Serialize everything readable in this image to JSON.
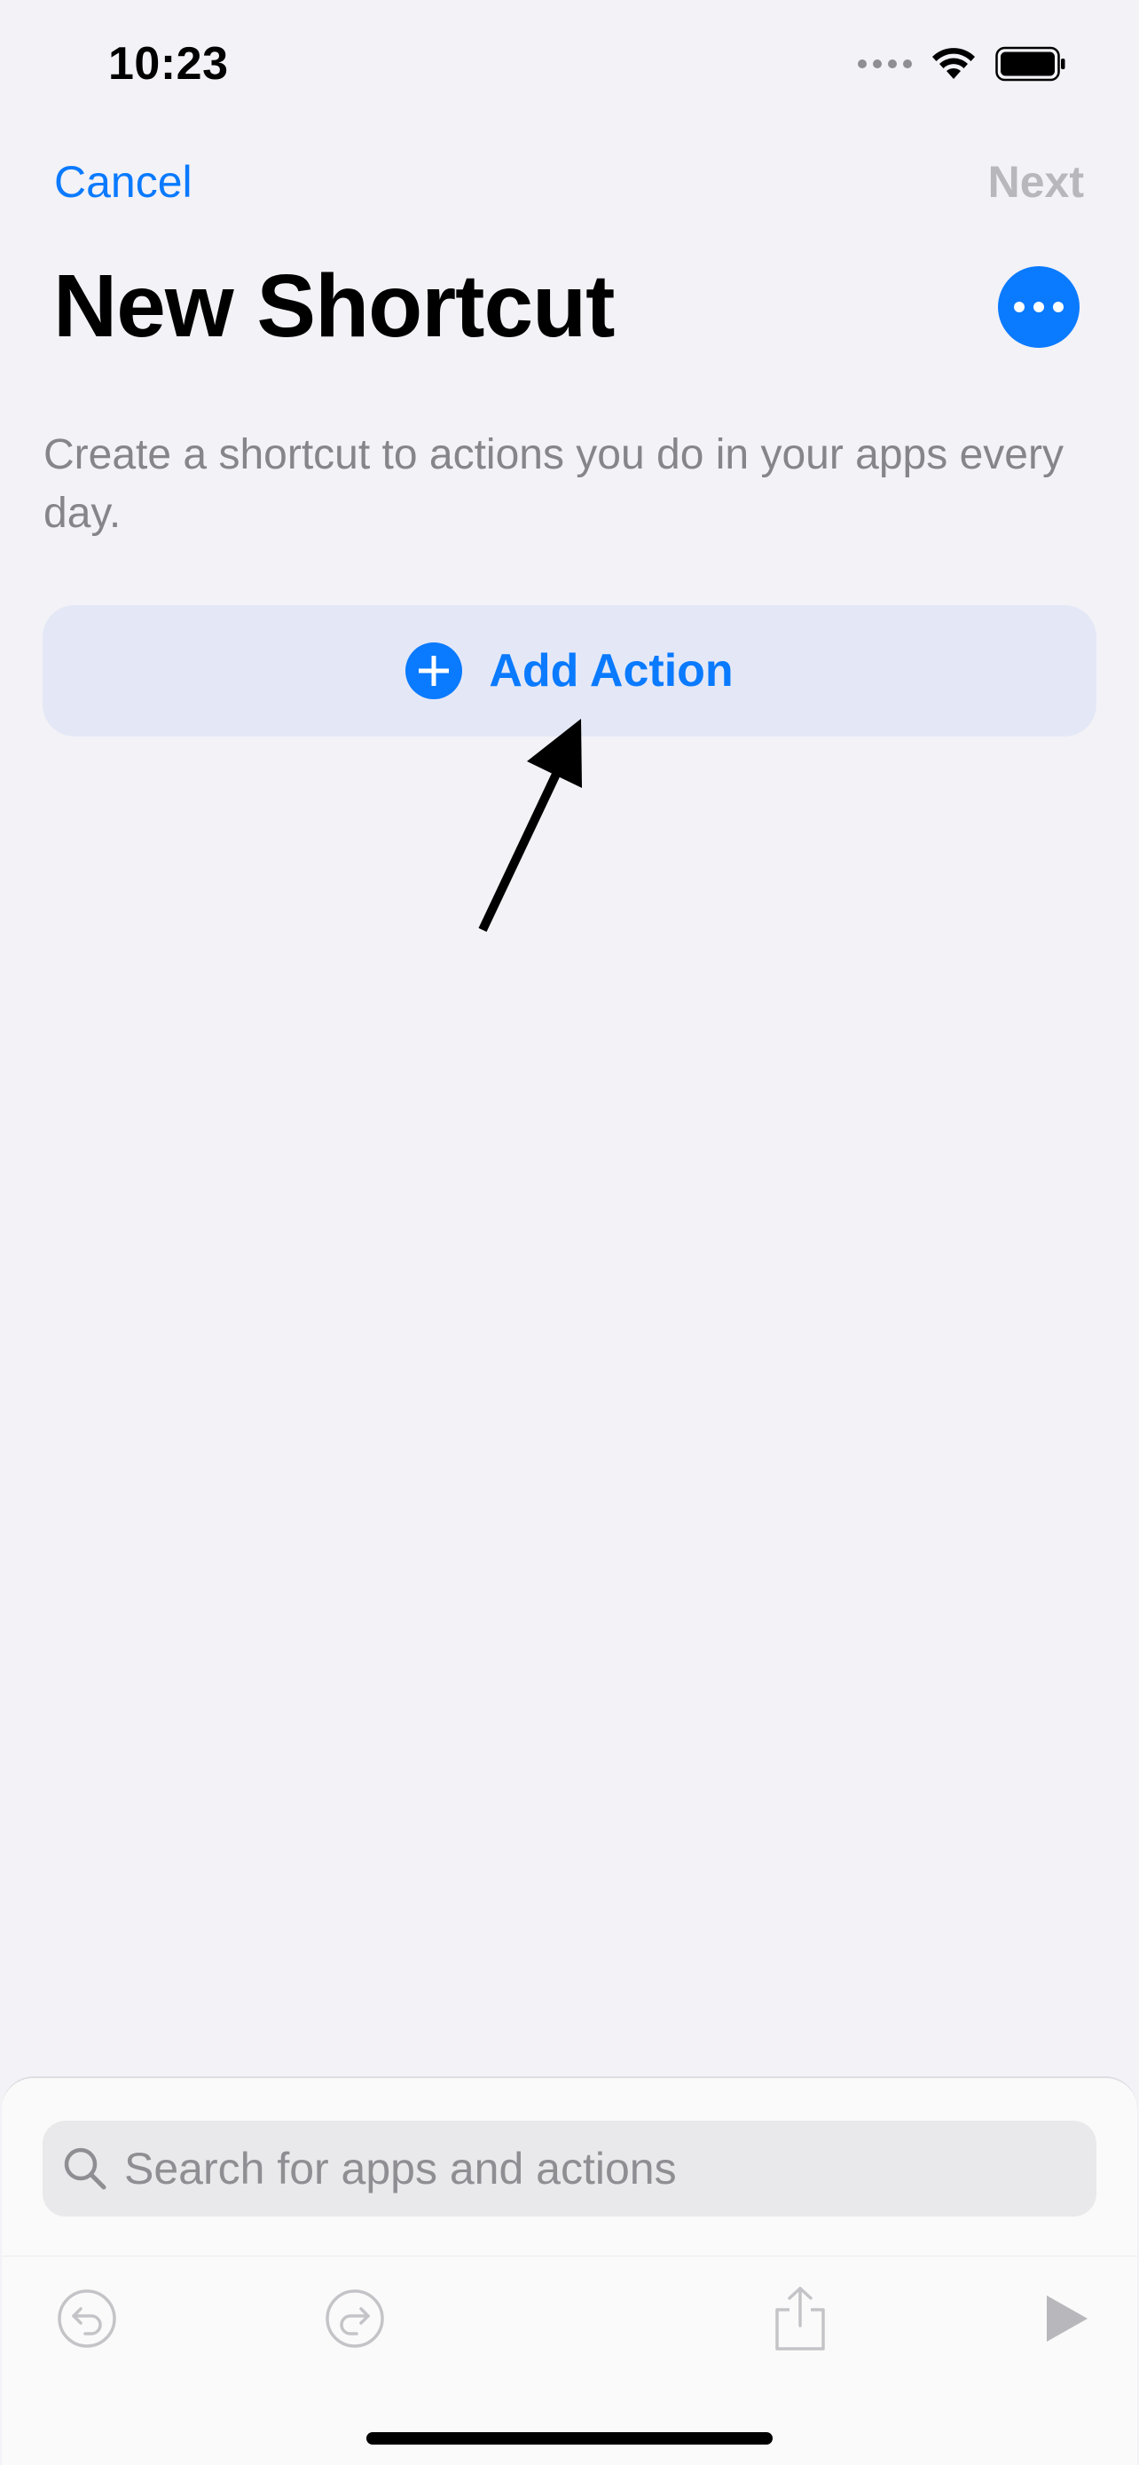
{
  "status_bar": {
    "time": "10:23"
  },
  "nav": {
    "cancel_label": "Cancel",
    "next_label": "Next"
  },
  "title": "New Shortcut",
  "description": "Create a shortcut to actions you do in your apps every day.",
  "add_action": {
    "label": "Add Action"
  },
  "search": {
    "placeholder": "Search for apps and actions"
  },
  "toolbar": {
    "undo_icon": "undo-icon",
    "redo_icon": "redo-icon",
    "share_icon": "share-icon",
    "play_icon": "play-icon"
  },
  "colors": {
    "accent": "#0a7aff",
    "background": "#f2f2f7",
    "disabled": "#b8b8bc",
    "secondary_text": "#85858a"
  }
}
